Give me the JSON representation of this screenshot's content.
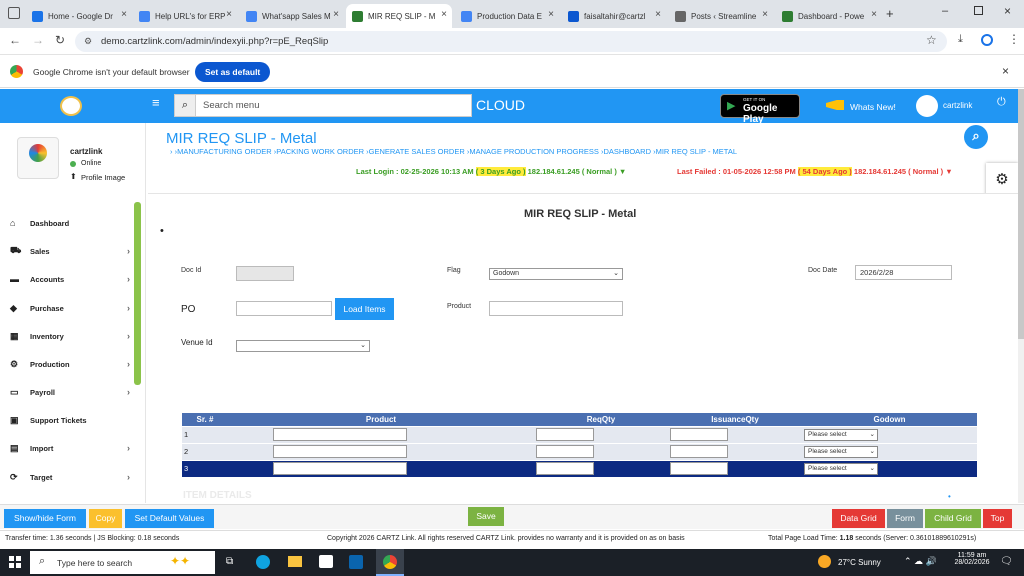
{
  "browser": {
    "tabs": [
      {
        "label": "Home - Google Dr",
        "color": "#1a73e8"
      },
      {
        "label": "Help URL's for ERP",
        "color": "#4285f4"
      },
      {
        "label": "What'sapp Sales M",
        "color": "#4285f4"
      },
      {
        "label": "MIR REQ SLIP - M",
        "color": "#2e7d32"
      },
      {
        "label": "Production Data E",
        "color": "#4285f4"
      },
      {
        "label": "faisaltahir@cartzl",
        "color": "#0b57d0"
      },
      {
        "label": "Posts ‹ Streamline",
        "color": "#666"
      },
      {
        "label": "Dashboard - Powe",
        "color": "#2e7d32"
      }
    ],
    "url": "demo.cartzlink.com/admin/indexyii.php?r=pE_ReqSlip",
    "default_msg": "Google Chrome isn't your default browser",
    "set_default": "Set as default"
  },
  "header": {
    "search_placeholder": "Search menu",
    "cloud": "CLOUD",
    "get_it_on": "GET IT ON",
    "gplay": "Google Play",
    "whats_new": "Whats New!",
    "user": "cartzlink"
  },
  "sidebar": {
    "user": "cartzlink",
    "status": "Online",
    "profile": "Profile Image",
    "items": [
      {
        "label": "Dashboard",
        "icon": "home-icon",
        "chevron": ""
      },
      {
        "label": "Sales",
        "icon": "cart-icon",
        "chevron": "›"
      },
      {
        "label": "Accounts",
        "icon": "bank-icon",
        "chevron": "›"
      },
      {
        "label": "Purchase",
        "icon": "tag-icon",
        "chevron": "›"
      },
      {
        "label": "Inventory",
        "icon": "grid-icon",
        "chevron": "›"
      },
      {
        "label": "Production",
        "icon": "gears-icon",
        "chevron": "›"
      },
      {
        "label": "Payroll",
        "icon": "money-icon",
        "chevron": "›"
      },
      {
        "label": "Support Tickets",
        "icon": "ticket-icon",
        "chevron": ""
      },
      {
        "label": "Import",
        "icon": "import-icon",
        "chevron": "›"
      },
      {
        "label": "Target",
        "icon": "refresh-icon",
        "chevron": "›"
      }
    ]
  },
  "page": {
    "title": "MIR REQ SLIP - Metal",
    "breadcrumb": "› ›MANUFACTURING ORDER ›PACKING WORK ORDER ›GENERATE SALES ORDER ›MANAGE PRODUCTION PROGRESS ›DASHBOARD ›MIR REQ SLIP - METAL",
    "last_login_prefix": "Last Login : 02-25-2026 10:13 AM",
    "last_login_days": "( 3 Days Ago )",
    "last_login_suffix": "182.184.61.245 ( Normal ) ▼",
    "last_failed_prefix": "Last Failed : 01-05-2026 12:58 PM",
    "last_failed_days": "( 54 Days Ago )",
    "last_failed_suffix": "182.184.61.245 ( Normal ) ▼",
    "form_title": "MIR REQ SLIP - Metal"
  },
  "form": {
    "doc_id_label": "Doc Id",
    "doc_id": "",
    "flag_label": "Flag",
    "flag": "Godown",
    "doc_date_label": "Doc Date",
    "doc_date": "2026/2/28",
    "po_label": "PO",
    "po": "",
    "load_items": "Load Items",
    "product_label": "Product",
    "product": "",
    "venue_label": "Venue Id",
    "venue": ""
  },
  "grid": {
    "headers": [
      "Sr. #",
      "Product",
      "ReqQty",
      "IssuanceQty",
      "Godown"
    ],
    "rows": [
      {
        "sr": "1",
        "godown": "Please select"
      },
      {
        "sr": "2",
        "godown": "Please select"
      },
      {
        "sr": "3",
        "godown": "Please select"
      }
    ],
    "item_details": "ITEM DETAILS"
  },
  "actions": {
    "show_hide": "Show/hide Form",
    "copy": "Copy",
    "set_default": "Set Default Values",
    "save": "Save",
    "data_grid": "Data Grid",
    "form": "Form",
    "child_grid": "Child Grid",
    "top": "Top"
  },
  "status": {
    "transfer": "Transfer time: 1.36 seconds  | JS Blocking: 0.18 seconds",
    "copyright": "Copyright 2026 CARTZ Link. All rights reserved CARTZ Link. provides no warranty and it is provided on as on basis",
    "load_prefix": "Total Page Load Time:",
    "load_value": "1.18",
    "load_suffix": "seconds (Server: 0.36101889610291s)"
  },
  "taskbar": {
    "search": "Type here to search",
    "weather": "27°C  Sunny",
    "time": "11:59 am",
    "date": "28/02/2026"
  },
  "colors": {
    "primary": "#2196f3",
    "green": "#4caf50",
    "red": "#e53935"
  }
}
